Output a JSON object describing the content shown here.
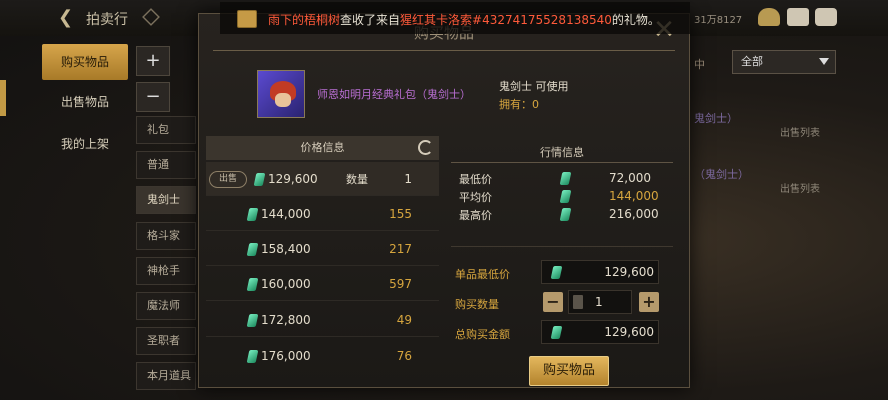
{
  "top_bar": {
    "title": "拍卖行",
    "coin_text": "31万8127"
  },
  "left_tabs": [
    {
      "label": "购买物品",
      "active": true
    },
    {
      "label": "出售物品",
      "active": false
    },
    {
      "label": "我的上架",
      "active": false
    }
  ],
  "categories": [
    "礼包",
    "普通",
    "鬼剑士",
    "格斗家",
    "神枪手",
    "魔法师",
    "圣职者",
    "本月道具"
  ],
  "category_buttons": {
    "add": "+",
    "remove": "−"
  },
  "right_panel": {
    "col_label": "中",
    "dropdown_value": "全部",
    "row1_name": "鬼剑士）",
    "row1_link": "出售列表",
    "row2_name": "（鬼剑士）",
    "row2_link": "出售列表"
  },
  "notification": {
    "sender": "雨下的梧桐树",
    "mid": "查收了来自",
    "from": "猩红其卡洛索#4327417552813854​0",
    "suffix": "的礼物。"
  },
  "modal": {
    "title": "购买物品",
    "item_name": "师恩如明月经典礼包（鬼剑士）",
    "item_class": "鬼剑士 可使用",
    "item_owned": "拥有：0",
    "price_header": "价格信息",
    "sell_badge": "出售",
    "qty_label": "数量",
    "listings": [
      {
        "price": "129,600",
        "qty": "1"
      },
      {
        "price": "144,000",
        "qty": "155"
      },
      {
        "price": "158,400",
        "qty": "217"
      },
      {
        "price": "160,000",
        "qty": "597"
      },
      {
        "price": "172,800",
        "qty": "49"
      },
      {
        "price": "176,000",
        "qty": "76"
      }
    ],
    "market_header": "行情信息",
    "market": [
      {
        "label": "最低价",
        "value": "72,000"
      },
      {
        "label": "平均价",
        "value": "144,000"
      },
      {
        "label": "最高价",
        "value": "216,000"
      }
    ],
    "form": {
      "unit_min_label": "单品最低价",
      "unit_min_value": "129,600",
      "qty_label": "购买数量",
      "qty_value": "1",
      "total_label": "总购买金额",
      "total_value": "129,600"
    },
    "buy_button": "购买物品"
  },
  "colors": {
    "accent_gold": "#d6a53e",
    "item_purple": "#b86ed2",
    "notice_red": "#ff5a3a"
  }
}
